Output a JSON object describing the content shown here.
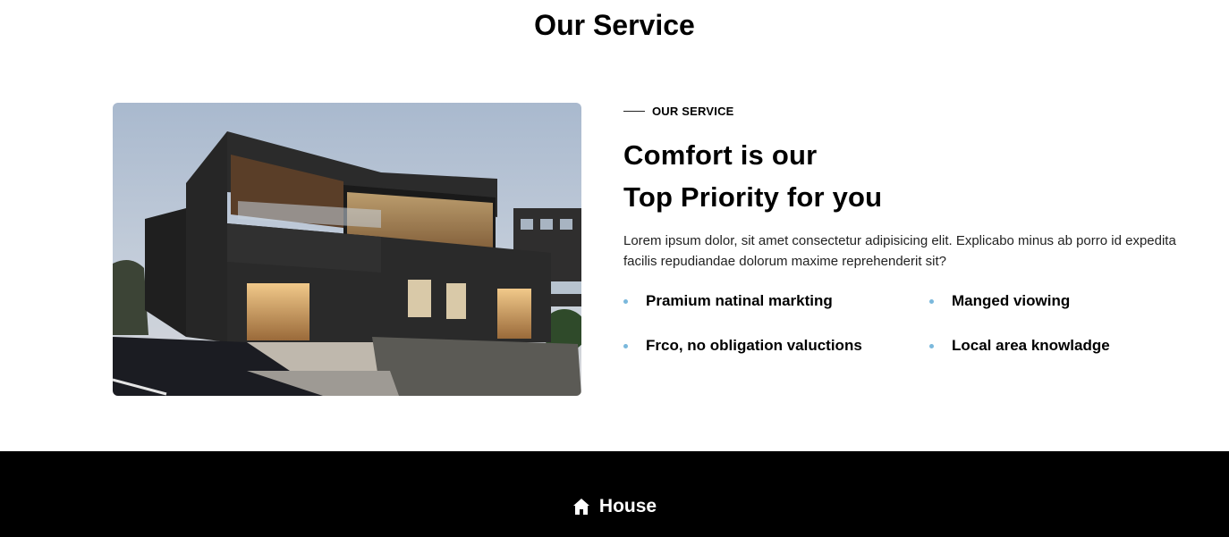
{
  "section": {
    "title": "Our Service"
  },
  "about": {
    "eyebrow": "OUR SERVICE",
    "headline_line1": "Comfort is our",
    "headline_line2": "Top Priority for you",
    "description": "Lorem ipsum dolor, sit amet consectetur adipisicing elit. Explicabo minus ab porro id expedita facilis repudiandae dolorum maxime reprehenderit sit?",
    "features": [
      "Pramium natinal markting",
      "Manged viowing",
      "Frco, no obligation valuctions",
      "Local area knowladge"
    ],
    "bullet_color": "#7ab8dc"
  },
  "footer": {
    "brand": "House",
    "brand_icon": "home-icon",
    "background": "#000000"
  }
}
